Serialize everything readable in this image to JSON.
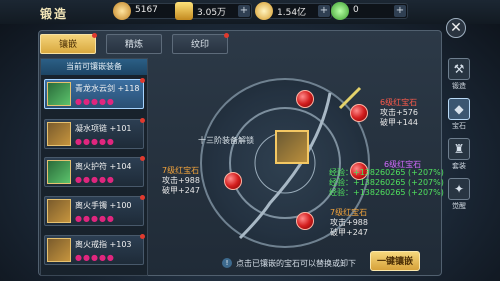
{
  "header": {
    "title": "锻造",
    "currencies": [
      {
        "icon": "gem-currency-icon",
        "value": "5167"
      },
      {
        "icon": "gold-bar-icon",
        "value": "3.05万"
      },
      {
        "icon": "coin-icon",
        "value": "1.54亿"
      },
      {
        "icon": "jade-icon",
        "value": "0"
      }
    ]
  },
  "tabs": [
    {
      "label": "镶嵌",
      "active": true
    },
    {
      "label": "精炼",
      "active": false
    },
    {
      "label": "纹印",
      "active": false
    }
  ],
  "equip_list": {
    "header": "当前可镶嵌装备",
    "items": [
      {
        "name": "青龙水云剑 +118",
        "gems": "●●●●●",
        "selected": true
      },
      {
        "name": "凝水项链 +101",
        "gems": "●●●●●",
        "selected": false
      },
      {
        "name": "离火护符 +104",
        "gems": "●●●●●",
        "selected": false
      },
      {
        "name": "离火手镯 +100",
        "gems": "●●●●●",
        "selected": false
      },
      {
        "name": "离火戒指 +103",
        "gems": "●●●●●",
        "selected": false
      }
    ]
  },
  "socket": {
    "unlock_text": "十三阶装备解锁",
    "gems": [
      {
        "title": "6级红宝石",
        "line1": "攻击+576",
        "line2": "破甲+144"
      },
      {
        "title": "7级红宝石",
        "line1": "攻击+988",
        "line2": "破甲+247"
      },
      {
        "title": "7级红宝石",
        "line1": "攻击+988",
        "line2": "破甲+247"
      },
      {
        "title": "6级红宝石",
        "line1": "攻击+576",
        "line2": "破甲+144"
      }
    ],
    "exp_lines": [
      "经验：+138260265 (+207%)",
      "经验：+138260265 (+207%)",
      "经验：+138260265 (+207%)"
    ]
  },
  "footer": {
    "tip": "点击已镶嵌的宝石可以替换或卸下",
    "button": "一键镶嵌"
  },
  "sidebar": {
    "items": [
      {
        "label": "锻造",
        "icon": "anvil-icon"
      },
      {
        "label": "宝石",
        "icon": "gem-icon",
        "active": true
      },
      {
        "label": "套装",
        "icon": "armor-icon"
      },
      {
        "label": "觉醒",
        "icon": "awaken-icon"
      }
    ]
  }
}
